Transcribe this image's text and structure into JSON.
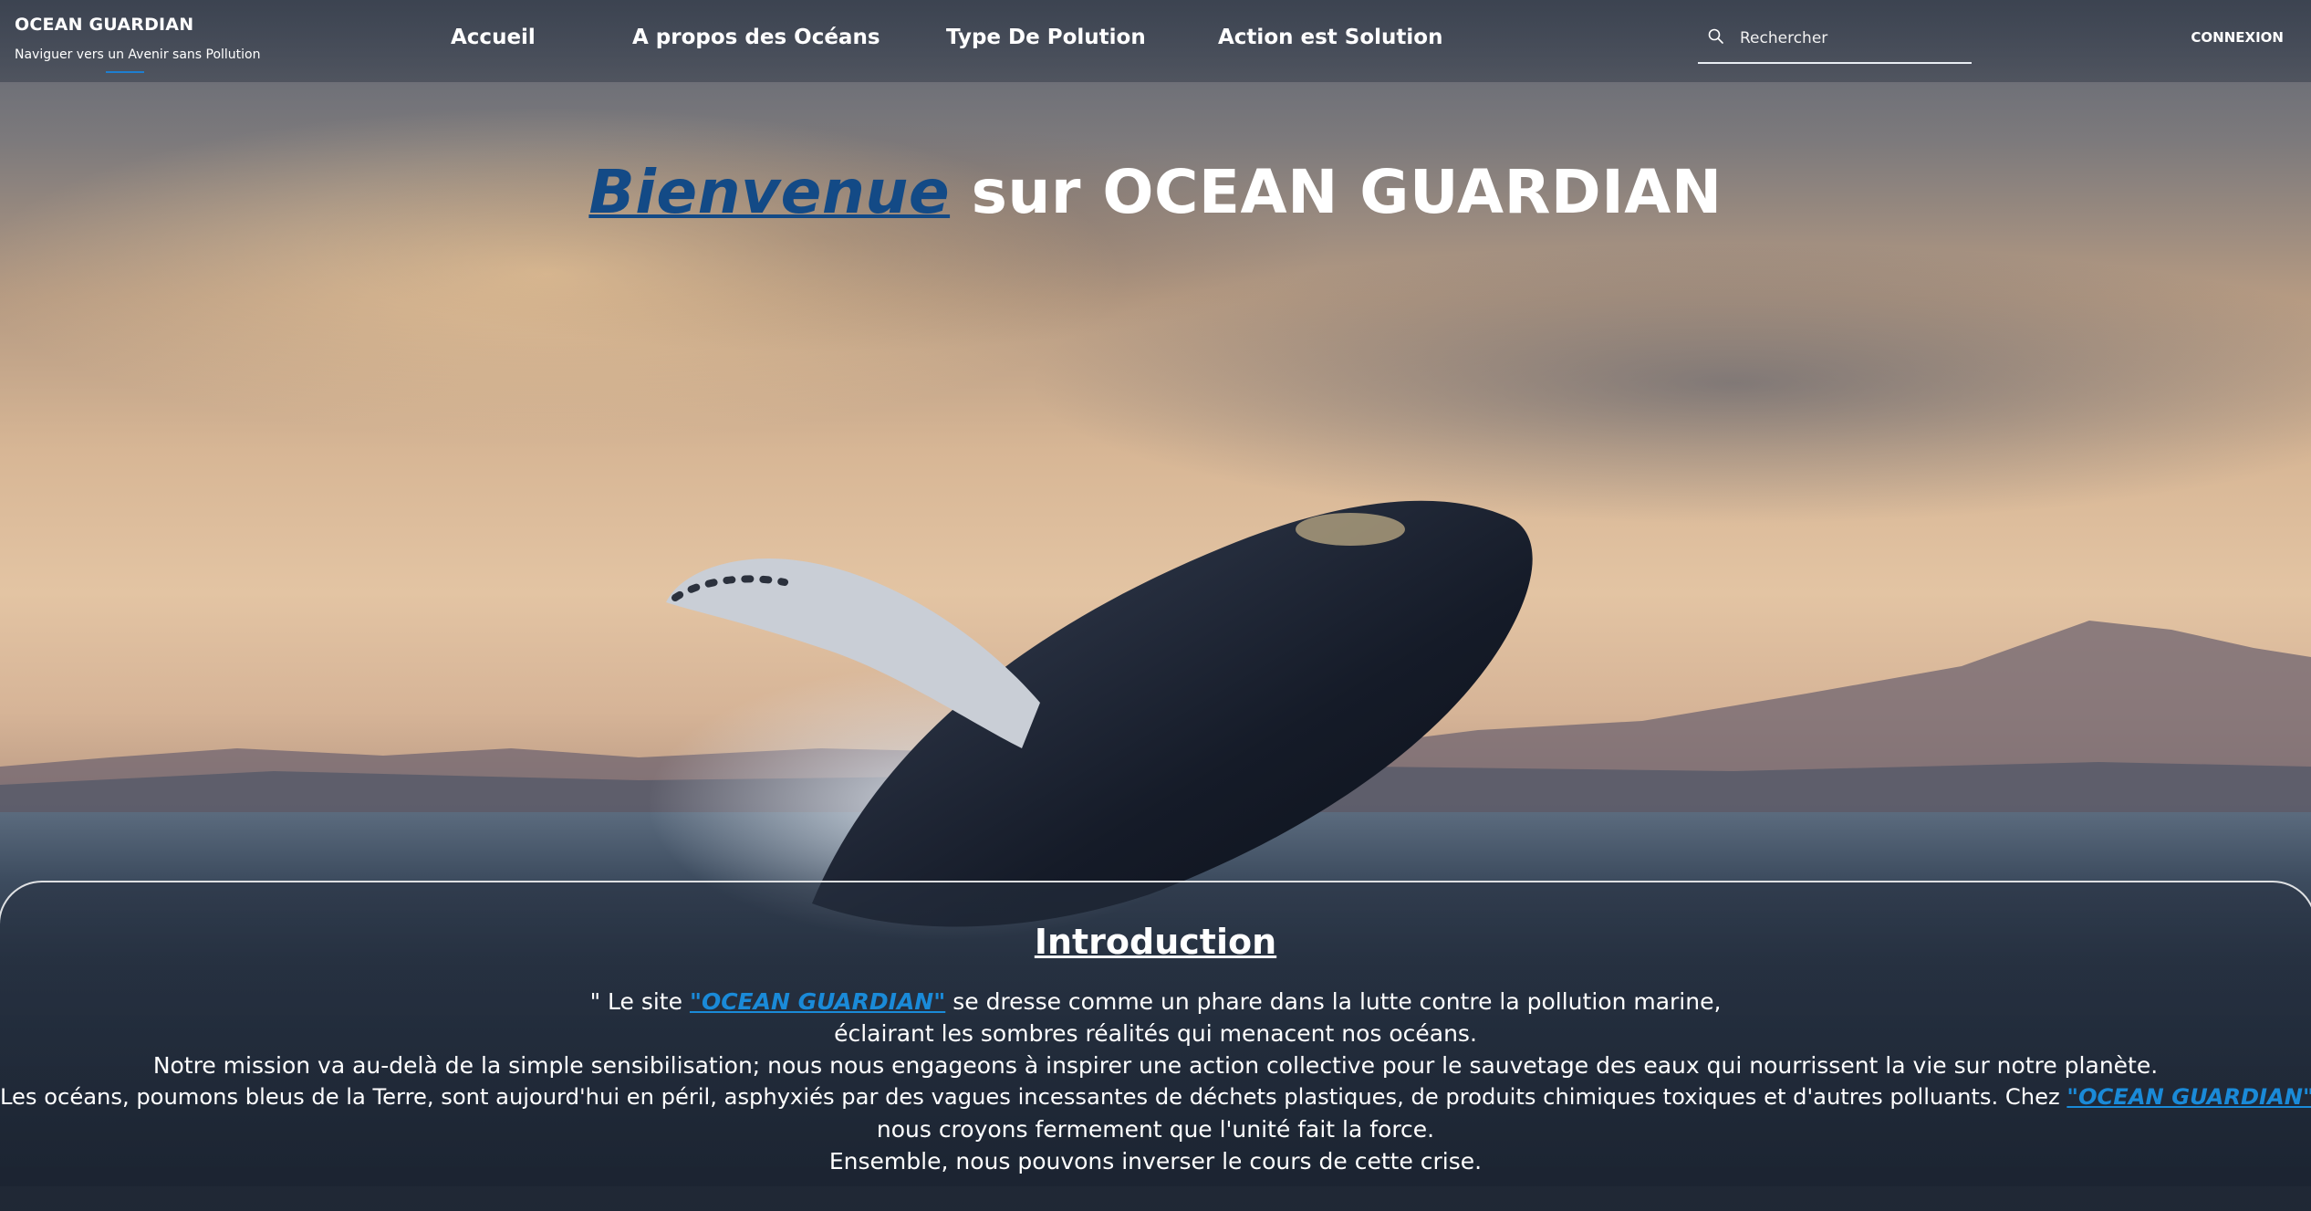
{
  "header": {
    "brand_title": "OCEAN GUARDIAN",
    "brand_subtitle": "Naviguer vers un Avenir sans Pollution",
    "nav": [
      "Accueil",
      "A propos des Océans",
      "Type De Polution",
      "Action est Solution"
    ],
    "search_placeholder": "Rechercher",
    "search_value": "",
    "login_label": "CONNEXION"
  },
  "hero": {
    "title_accent": "Bienvenue",
    "title_rest": " sur OCEAN GUARDIAN"
  },
  "intro": {
    "title": "Introduction",
    "line1_before": "\" Le site ",
    "brand_link": "\"OCEAN GUARDIAN\"",
    "line1_after": " se dresse comme un phare dans la lutte contre la pollution marine,",
    "line2": "éclairant les sombres réalités qui menacent nos océans.",
    "line3": "Notre mission va au-delà de la simple sensibilisation; nous nous engageons à inspirer une action collective pour le sauvetage des eaux qui nourrissent la vie sur notre planète.",
    "line4_before": "Les océans, poumons bleus de la Terre, sont aujourd'hui en péril, asphyxiés par des vagues incessantes de déchets plastiques, de produits chimiques toxiques et d'autres polluants. Chez ",
    "line4_after": ",",
    "line5": "nous croyons fermement que l'unité fait la force.",
    "line6": "Ensemble, nous pouvons inverser le cours de cette crise."
  },
  "colors": {
    "accent_blue": "#134a86",
    "link_blue": "#1a8ad8",
    "underline_blue": "#1e7fd0"
  },
  "icons": {
    "search": "search-icon"
  }
}
